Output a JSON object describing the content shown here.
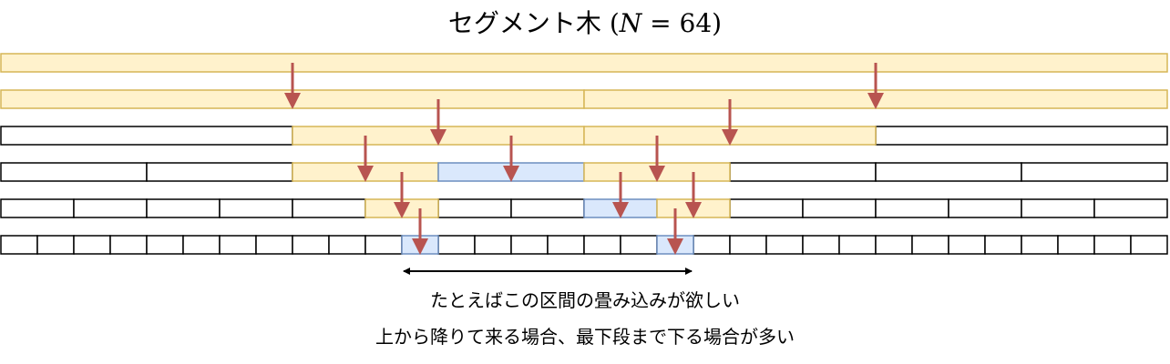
{
  "title": {
    "text": "セグメント木",
    "math_open": "(",
    "math_var": "N",
    "math_rest": " = 64)"
  },
  "tree": {
    "levels": [
      1,
      2,
      4,
      8,
      16,
      32
    ],
    "highlight_yellow": [
      [
        0,
        0,
        0
      ],
      [
        1,
        0,
        1
      ],
      [
        2,
        1,
        2
      ],
      [
        3,
        2,
        2
      ],
      [
        3,
        4,
        4
      ],
      [
        4,
        5,
        5
      ],
      [
        4,
        9,
        9
      ]
    ],
    "highlight_blue": [
      [
        3,
        3,
        3
      ],
      [
        4,
        8,
        8
      ],
      [
        5,
        11,
        11
      ],
      [
        5,
        18,
        18
      ]
    ],
    "arrows": [
      [
        1,
        0
      ],
      [
        1,
        1
      ],
      [
        2,
        1
      ],
      [
        2,
        2
      ],
      [
        3,
        2
      ],
      [
        3,
        3
      ],
      [
        3,
        4
      ],
      [
        4,
        5
      ],
      [
        4,
        8
      ],
      [
        4,
        9
      ],
      [
        5,
        11
      ],
      [
        5,
        18
      ]
    ],
    "range": {
      "from_leaf": 11,
      "to_leaf": 18
    }
  },
  "colors": {
    "yellow_fill": "#fff2cc",
    "yellow_stroke": "#d6b656",
    "blue_fill": "#dae8fc",
    "blue_stroke": "#6c8ebf",
    "arrow": "#b85450",
    "outline": "#000000"
  },
  "captions": {
    "line1": "たとえばこの区間の畳み込みが欲しい",
    "line2": "上から降りて来る場合、最下段まで下る場合が多い"
  }
}
